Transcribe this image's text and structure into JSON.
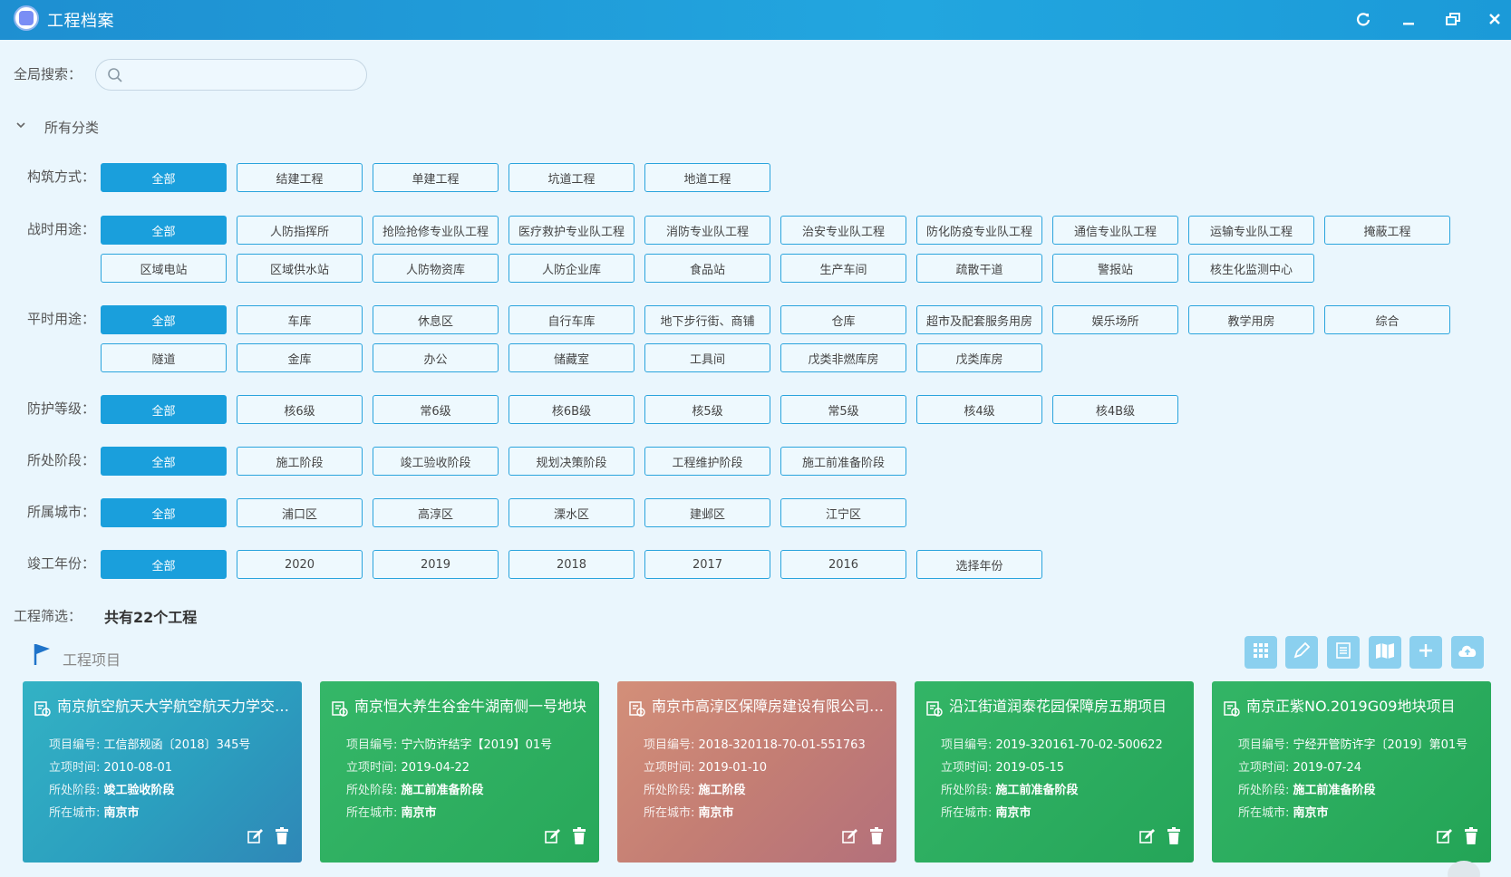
{
  "app": {
    "title": "工程档案",
    "colors": {
      "primary": "#1a9fdc",
      "titlebar": "#22a6df"
    },
    "window_icons": [
      "refresh-icon",
      "minimize-icon",
      "restore-icon",
      "close-icon"
    ]
  },
  "search": {
    "label": "全局搜索：",
    "placeholder": "",
    "value": ""
  },
  "categories": {
    "title": "所有分类"
  },
  "filters": {
    "construction": {
      "label": "构筑方式：",
      "options": [
        "全部",
        "结建工程",
        "单建工程",
        "坑道工程",
        "地道工程"
      ]
    },
    "wartime": {
      "label": "战时用途：",
      "options": [
        "全部",
        "人防指挥所",
        "抢险抢修专业队工程",
        "医疗救护专业队工程",
        "消防专业队工程",
        "治安专业队工程",
        "防化防疫专业队工程",
        "通信专业队工程",
        "运输专业队工程",
        "掩蔽工程",
        "区域电站",
        "区域供水站",
        "人防物资库",
        "人防企业库",
        "食品站",
        "生产车间",
        "疏散干道",
        "警报站",
        "核生化监测中心"
      ]
    },
    "peacetime": {
      "label": "平时用途：",
      "options": [
        "全部",
        "车库",
        "休息区",
        "自行车库",
        "地下步行街、商铺",
        "仓库",
        "超市及配套服务用房",
        "娱乐场所",
        "教学用房",
        "综合",
        "隧道",
        "金库",
        "办公",
        "储藏室",
        "工具间",
        "戊类非燃库房",
        "戊类库房"
      ]
    },
    "protection": {
      "label": "防护等级：",
      "options": [
        "全部",
        "核6级",
        "常6级",
        "核6B级",
        "核5级",
        "常5级",
        "核4级",
        "核4B级"
      ]
    },
    "stage": {
      "label": "所处阶段：",
      "options": [
        "全部",
        "施工阶段",
        "竣工验收阶段",
        "规划决策阶段",
        "工程维护阶段",
        "施工前准备阶段"
      ]
    },
    "city": {
      "label": "所属城市：",
      "options": [
        "全部",
        "浦口区",
        "高淳区",
        "溧水区",
        "建邺区",
        "江宁区"
      ]
    },
    "year": {
      "label": "竣工年份：",
      "options": [
        "全部",
        "2020",
        "2019",
        "2018",
        "2017",
        "2016",
        "选择年份"
      ]
    }
  },
  "result": {
    "label": "工程筛选：",
    "count_text": "共有22个工程"
  },
  "section": {
    "title": "工程项目"
  },
  "toolbar": [
    "grid-icon",
    "edit-pen-icon",
    "list-icon",
    "map-icon",
    "plus-icon",
    "cloud-upload-icon"
  ],
  "field_labels": {
    "code": "项目编号:",
    "date": "立项时间:",
    "stage": "所处阶段:",
    "city": "所在城市:"
  },
  "projects": [
    {
      "title": "南京航空航天大学航空航天力学交叉研究中心",
      "code": "工信部规函〔2018〕345号",
      "date": "2010-08-01",
      "stage": "竣工验收阶段",
      "city": "南京市"
    },
    {
      "title": "南京恒大养生谷金牛湖南侧一号地块",
      "code": "宁六防许结字【2019】01号",
      "date": "2019-04-22",
      "stage": "施工前准备阶段",
      "city": "南京市"
    },
    {
      "title": "南京市高淳区保障房建设有限公司项目",
      "code": "2018-320118-70-01-551763",
      "date": "2019-01-10",
      "stage": "施工阶段",
      "city": "南京市"
    },
    {
      "title": "沿江街道润泰花园保障房五期项目",
      "code": "2019-320161-70-02-500622",
      "date": "2019-05-15",
      "stage": "施工前准备阶段",
      "city": "南京市"
    },
    {
      "title": "南京正紫NO.2019G09地块项目",
      "code": "宁经开管防许字〔2019〕第01号",
      "date": "2019-07-24",
      "stage": "施工前准备阶段",
      "city": "南京市"
    }
  ]
}
